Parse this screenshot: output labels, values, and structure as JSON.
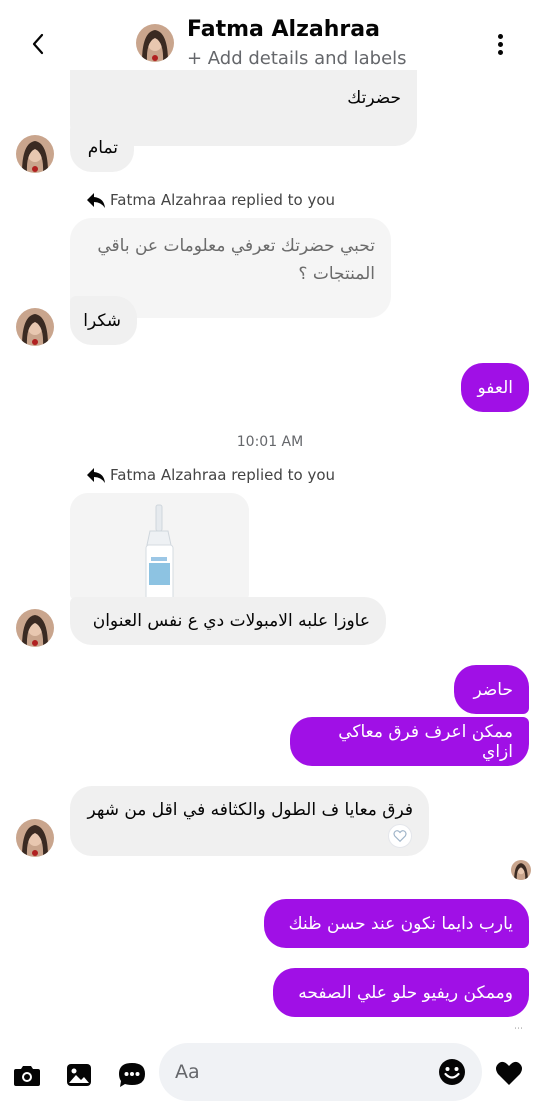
{
  "header": {
    "contact_name": "Fatma Alzahraa",
    "subtitle": "+ Add details and labels",
    "back_icon": "chevron-left-icon",
    "more_icon": "vertical-dots-icon"
  },
  "messages": {
    "m1_text": "حضرتك",
    "m2_text": "تمام",
    "reply1_text": "Fatma Alzahraa replied to you",
    "quoted1_text": "تحبي حضرتك تعرفي معلومات عن باقي المنتجات ؟",
    "m3_text": "شكرا",
    "m4_text": "العفو",
    "timestamp": "10:01 AM",
    "reply2_text": "Fatma Alzahraa replied to you",
    "m5_text": "عاوزا علبه الامبولات دي ع نفس العنوان",
    "m6_text": "حاضر",
    "m7_text": "ممكن اعرف فرق معاكي ازاي",
    "m8_text": "فرق معايا ف الطول والكثافه في اقل من شهر",
    "m9_text": "يارب دايما نكون عند حسن ظنك",
    "m10_text": "وممكن ريفيو حلو علي الصفحه",
    "reaction_icon": "heart-reaction-icon"
  },
  "composer": {
    "placeholder": "Aa",
    "camera_icon": "camera-icon",
    "gallery_icon": "image-icon",
    "chat_icon": "chat-bubble-icon",
    "emoji_icon": "emoji-icon",
    "like_icon": "heart-icon"
  },
  "colors": {
    "outgoing_bubble": "#a010e6",
    "incoming_bubble": "#f0f0f0",
    "text_primary": "#050505",
    "text_secondary": "#65676b"
  }
}
